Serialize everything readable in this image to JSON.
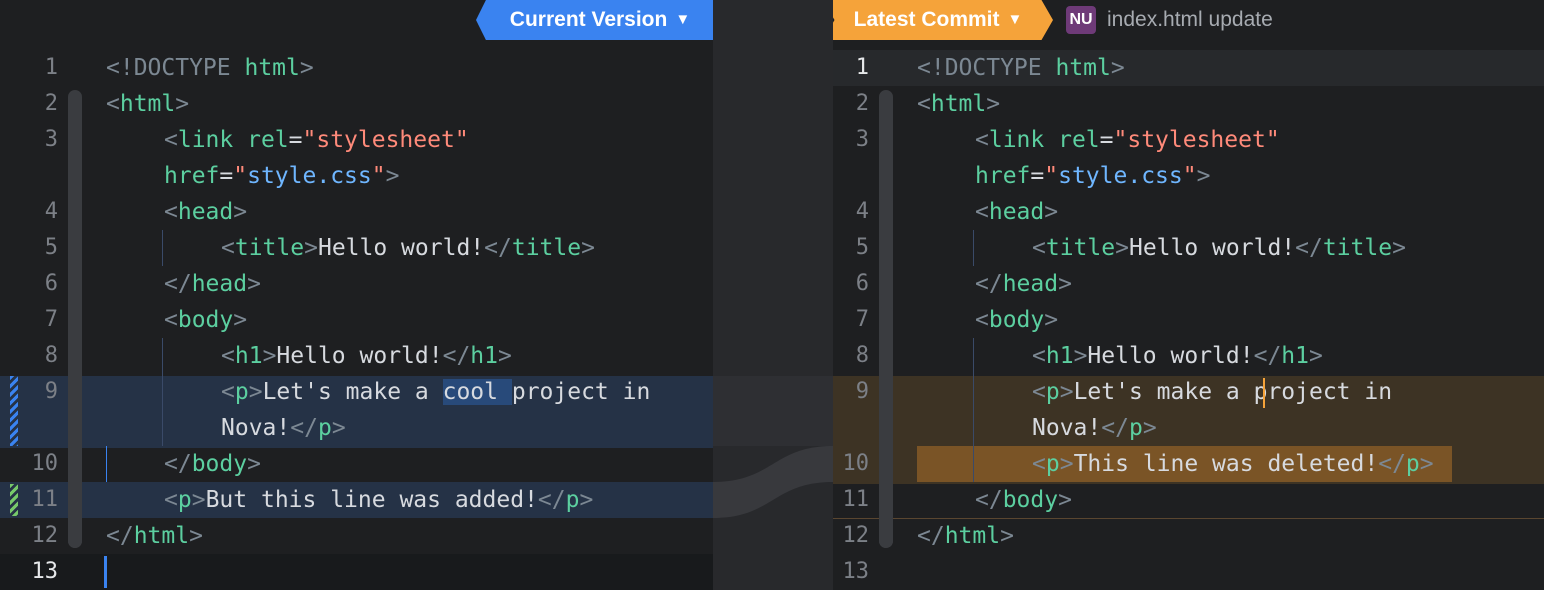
{
  "header": {
    "current_tab": "Current Version",
    "latest_tab": "Latest Commit",
    "badge": "NU",
    "commit_message": "index.html update",
    "icons": [
      "chevron-down-icon"
    ]
  },
  "colors": {
    "current_accent": "#3a83f0",
    "latest_accent": "#f5a33a"
  },
  "left": {
    "line_numbers": [
      "1",
      "2",
      "3",
      "4",
      "5",
      "6",
      "7",
      "8",
      "9",
      "10",
      "11",
      "12",
      "13"
    ],
    "lines": {
      "l1": {
        "a": "<!DOCTYPE ",
        "b": "html",
        "c": ">"
      },
      "l2": {
        "a": "<",
        "b": "html",
        "c": ">"
      },
      "l3": {
        "a": "<",
        "b": "link",
        "c": " rel",
        "d": "=",
        "e": "\"stylesheet\""
      },
      "l3w": {
        "a": "href",
        "b": "=",
        "c": "\"",
        "d": "style.css",
        "e": "\"",
        "f": ">"
      },
      "l4": {
        "a": "<",
        "b": "head",
        "c": ">"
      },
      "l5": {
        "a": "<",
        "b": "title",
        "c": ">",
        "d": "Hello world!",
        "e": "</",
        "f": "title",
        "g": ">"
      },
      "l6": {
        "a": "</",
        "b": "head",
        "c": ">"
      },
      "l7": {
        "a": "<",
        "b": "body",
        "c": ">"
      },
      "l8": {
        "a": "<",
        "b": "h1",
        "c": ">",
        "d": "Hello world!",
        "e": "</",
        "f": "h1",
        "g": ">"
      },
      "l9": {
        "a": "<",
        "b": "p",
        "c": ">",
        "d": "Let's make a ",
        "e": "cool ",
        "f": "project in"
      },
      "l9w": {
        "a": "Nova!",
        "b": "</",
        "c": "p",
        "d": ">"
      },
      "l10": {
        "a": "</",
        "b": "body",
        "c": ">"
      },
      "l11": {
        "a": "<",
        "b": "p",
        "c": ">",
        "d": "But this line was added!",
        "e": "</",
        "f": "p",
        "g": ">"
      },
      "l12": {
        "a": "</",
        "b": "html",
        "c": ">"
      }
    }
  },
  "right": {
    "line_numbers": [
      "1",
      "2",
      "3",
      "4",
      "5",
      "6",
      "7",
      "8",
      "9",
      "10",
      "11",
      "12",
      "13"
    ],
    "lines": {
      "l1": {
        "a": "<!DOCTYPE ",
        "b": "html",
        "c": ">"
      },
      "l2": {
        "a": "<",
        "b": "html",
        "c": ">"
      },
      "l3": {
        "a": "<",
        "b": "link",
        "c": " rel",
        "d": "=",
        "e": "\"stylesheet\""
      },
      "l3w": {
        "a": "href",
        "b": "=",
        "c": "\"",
        "d": "style.css",
        "e": "\"",
        "f": ">"
      },
      "l4": {
        "a": "<",
        "b": "head",
        "c": ">"
      },
      "l5": {
        "a": "<",
        "b": "title",
        "c": ">",
        "d": "Hello world!",
        "e": "</",
        "f": "title",
        "g": ">"
      },
      "l6": {
        "a": "</",
        "b": "head",
        "c": ">"
      },
      "l7": {
        "a": "<",
        "b": "body",
        "c": ">"
      },
      "l8": {
        "a": "<",
        "b": "h1",
        "c": ">",
        "d": "Hello world!",
        "e": "</",
        "f": "h1",
        "g": ">"
      },
      "l9": {
        "a": "<",
        "b": "p",
        "c": ">",
        "d": "Let's make a ",
        "e": "project in"
      },
      "l9w": {
        "a": "Nova!",
        "b": "</",
        "c": "p",
        "d": ">"
      },
      "l10": {
        "a": "<",
        "b": "p",
        "c": ">",
        "d": "This line was deleted!",
        "e": "</",
        "f": "p",
        "g": ">"
      },
      "l11": {
        "a": "</",
        "b": "body",
        "c": ">"
      },
      "l12": {
        "a": "</",
        "b": "html",
        "c": ">"
      }
    }
  }
}
